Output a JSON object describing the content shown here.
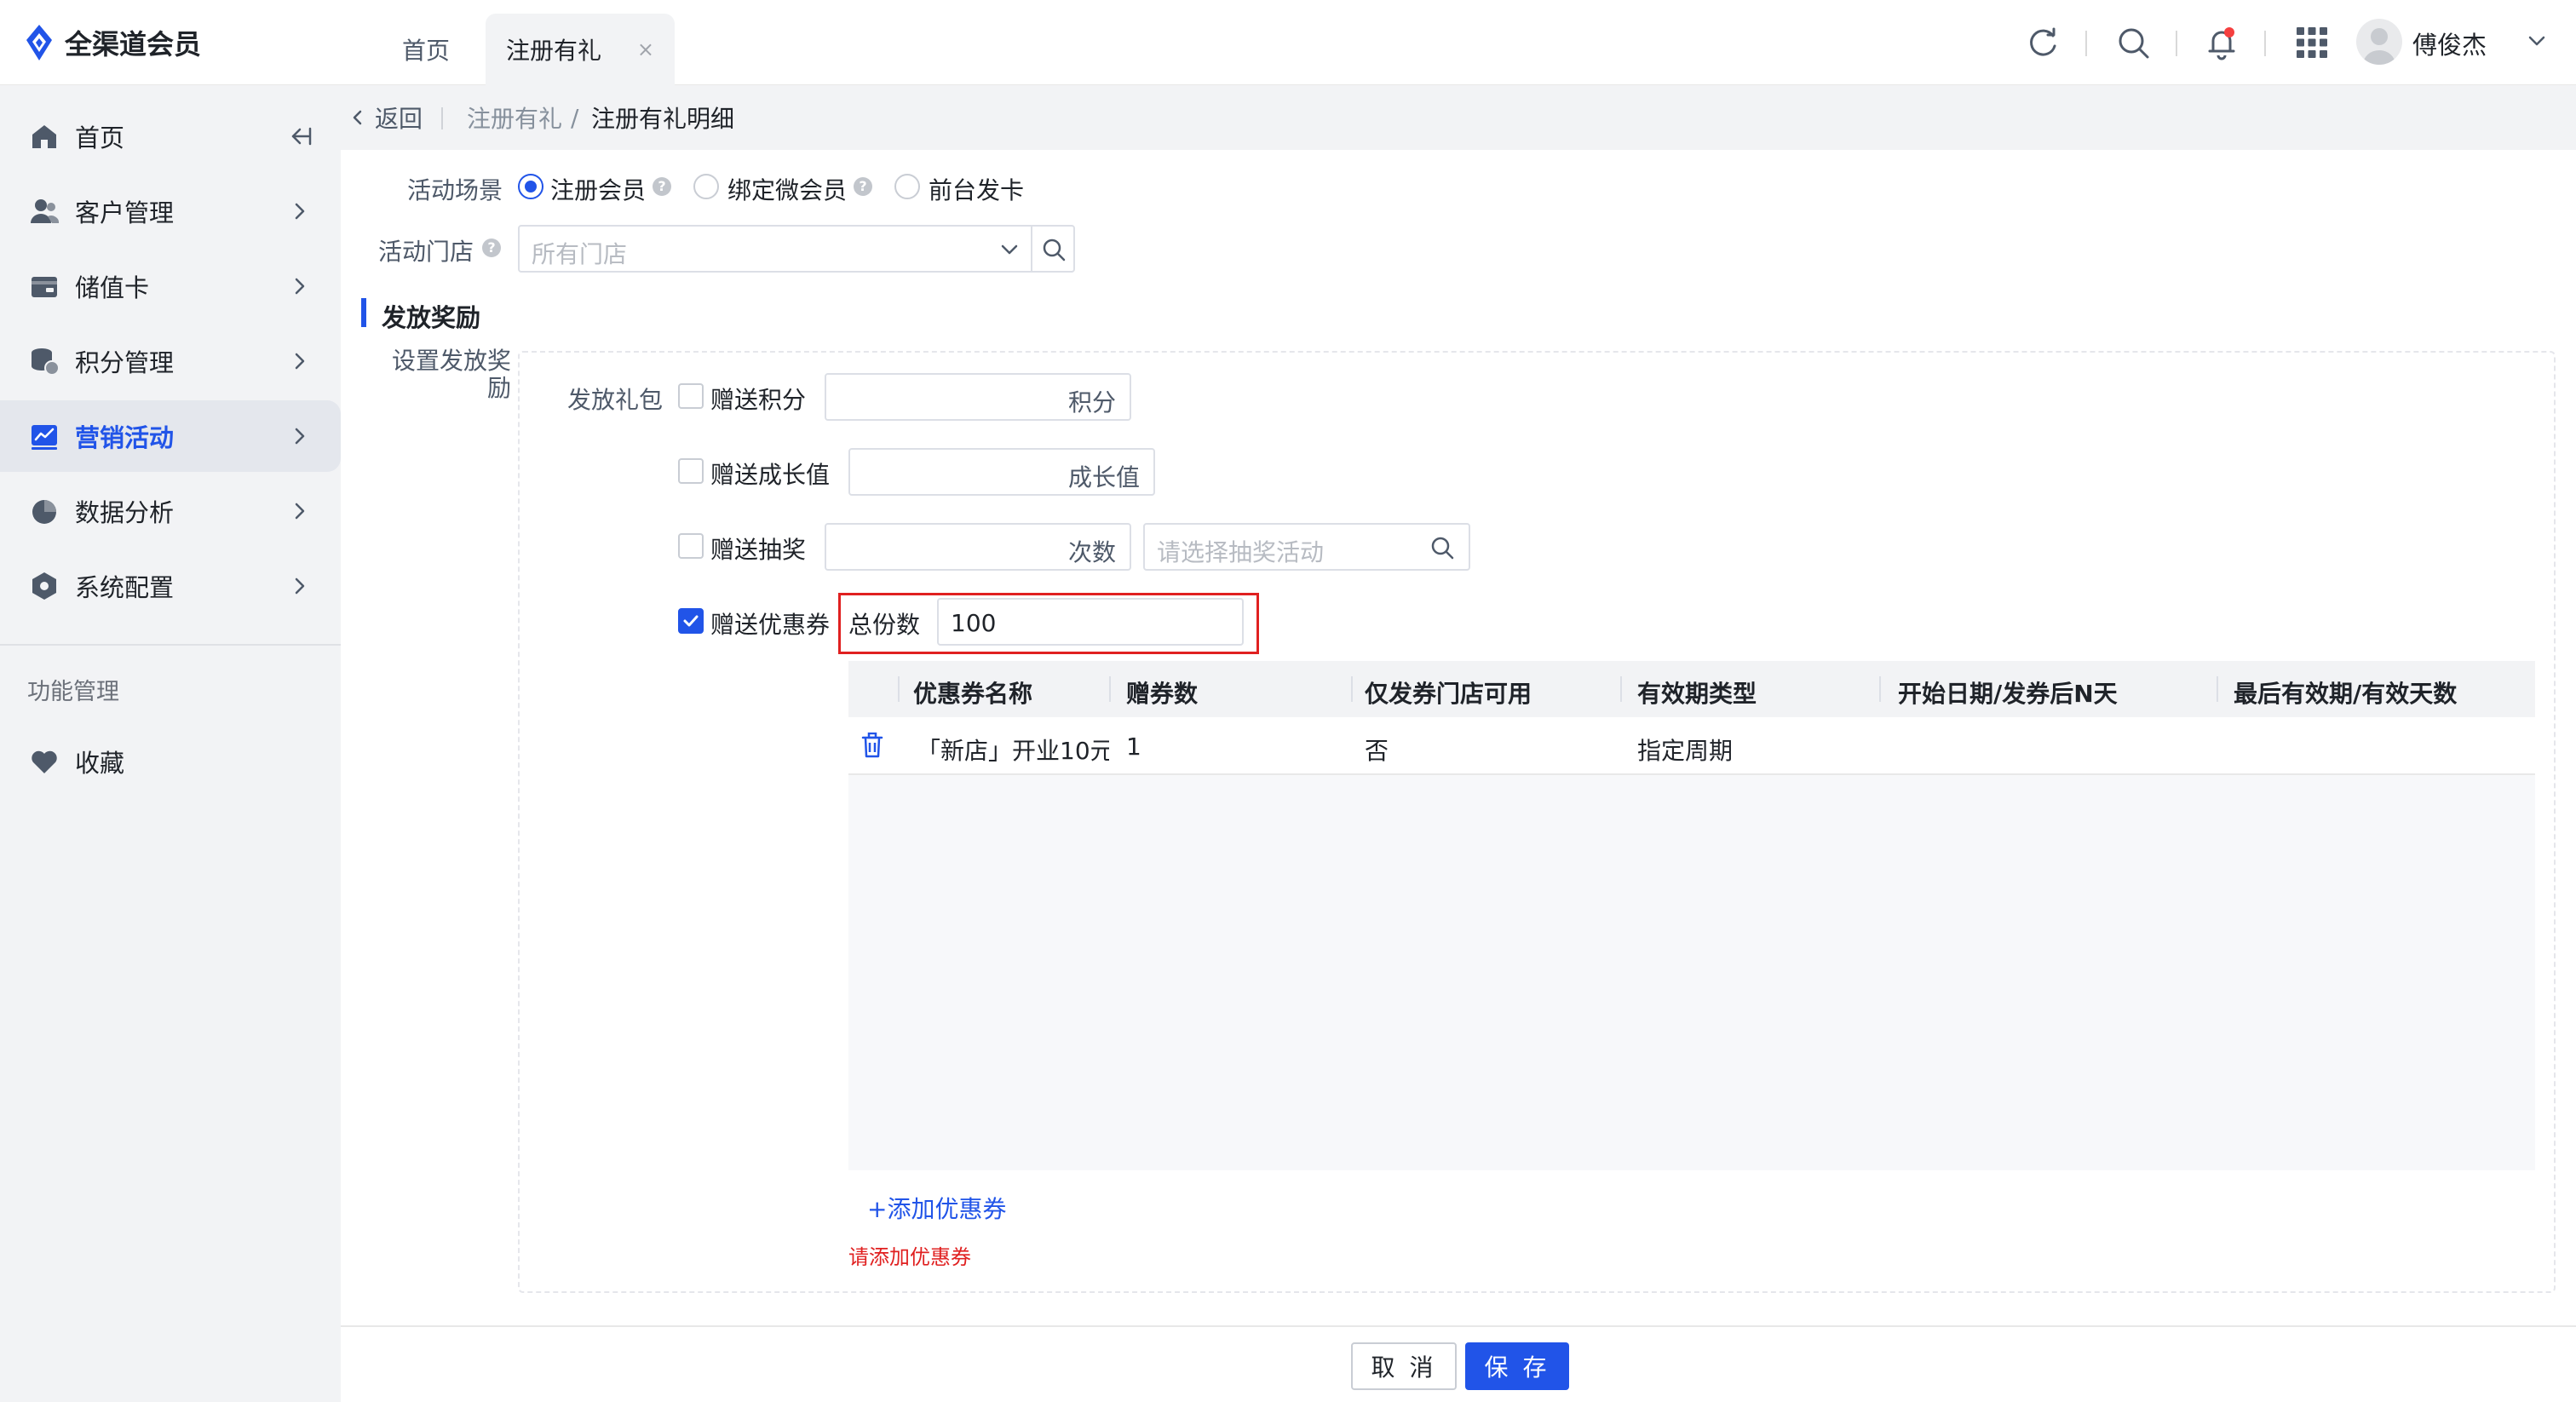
{
  "app": {
    "title": "全渠道会员"
  },
  "tabs": [
    {
      "label": "首页"
    },
    {
      "label": "注册有礼",
      "close": "×"
    }
  ],
  "user": {
    "name": "傅俊杰"
  },
  "sidebar": {
    "items": [
      {
        "label": "首页",
        "icon": "home-icon"
      },
      {
        "label": "客户管理",
        "icon": "users-icon"
      },
      {
        "label": "储值卡",
        "icon": "wallet-icon"
      },
      {
        "label": "积分管理",
        "icon": "coins-icon"
      },
      {
        "label": "营销活动",
        "icon": "trend-chart-icon",
        "active": true
      },
      {
        "label": "数据分析",
        "icon": "pie-chart-icon"
      },
      {
        "label": "系统配置",
        "icon": "settings-icon"
      }
    ],
    "section_label": "功能管理",
    "favorites": {
      "label": "收藏",
      "icon": "heart-icon"
    }
  },
  "breadcrumb": {
    "back": "返回",
    "parent": "注册有礼",
    "sep": "/",
    "current": "注册有礼明细"
  },
  "form": {
    "scene": {
      "label": "活动场景",
      "options": [
        {
          "label": "注册会员",
          "checked": true
        },
        {
          "label": "绑定微会员",
          "checked": false
        },
        {
          "label": "前台发卡",
          "checked": false
        }
      ]
    },
    "store": {
      "label": "活动门店",
      "placeholder": "所有门店"
    },
    "section_title": "发放奖励",
    "reward_label": "设置发放奖励",
    "gift_label": "发放礼包",
    "points": {
      "label": "赠送积分",
      "suffix": "积分",
      "checked": false
    },
    "growth": {
      "label": "赠送成长值",
      "suffix": "成长值",
      "checked": false
    },
    "lottery": {
      "label": "赠送抽奖",
      "suffix": "次数",
      "placeholder": "请选择抽奖活动",
      "checked": false
    },
    "coupon": {
      "label": "赠送优惠券",
      "checked": true,
      "total_label": "总份数",
      "total_value": "100"
    }
  },
  "coupon_table": {
    "columns": [
      "优惠券名称",
      "赠券数",
      "仅发券门店可用",
      "有效期类型",
      "开始日期/发券后N天",
      "最后有效期/有效天数"
    ],
    "rows": [
      {
        "name": "「新店」开业10元:",
        "count": "1",
        "store_only": "否",
        "validity_type": "指定周期",
        "start": "",
        "end": ""
      }
    ]
  },
  "add_coupon": "+添加优惠券",
  "error": "请添加优惠券",
  "footer": {
    "cancel": "取 消",
    "save": "保 存"
  },
  "colors": {
    "primary": "#2154e8",
    "error": "#e02020",
    "notify": "#f53f3f"
  }
}
